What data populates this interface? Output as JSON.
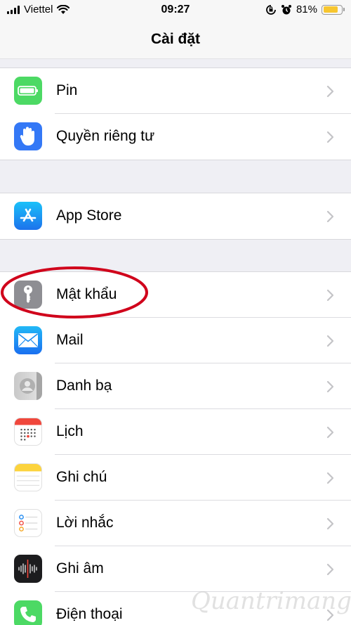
{
  "status": {
    "carrier": "Viettel",
    "time": "09:27",
    "battery": "81%",
    "battery_level": 0.81
  },
  "nav": {
    "title": "Cài đặt"
  },
  "groups": [
    {
      "items": [
        {
          "label": "Pin",
          "icon": "battery-icon",
          "color": "#4cd964"
        },
        {
          "label": "Quyền riêng tư",
          "icon": "hand-icon",
          "color": "#3478f6"
        }
      ]
    },
    {
      "items": [
        {
          "label": "App Store",
          "icon": "app-store-icon",
          "color": "#1f8ef1"
        }
      ]
    },
    {
      "items": [
        {
          "label": "Mật khẩu",
          "icon": "key-icon",
          "color": "#8e8e93"
        },
        {
          "label": "Mail",
          "icon": "mail-icon",
          "color": "#1e88f0"
        },
        {
          "label": "Danh bạ",
          "icon": "contacts-icon",
          "color": "#d6d6d6"
        },
        {
          "label": "Lịch",
          "icon": "calendar-icon",
          "color": "#ffffff"
        },
        {
          "label": "Ghi chú",
          "icon": "notes-icon",
          "color": "#ffffff"
        },
        {
          "label": "Lời nhắc",
          "icon": "reminders-icon",
          "color": "#ffffff"
        },
        {
          "label": "Ghi âm",
          "icon": "voice-memos-icon",
          "color": "#1c1c1e"
        },
        {
          "label": "Điện thoại",
          "icon": "phone-icon",
          "color": "#4cd964"
        }
      ]
    }
  ],
  "highlight_color": "#d0021b",
  "watermark": "Quantrimang"
}
